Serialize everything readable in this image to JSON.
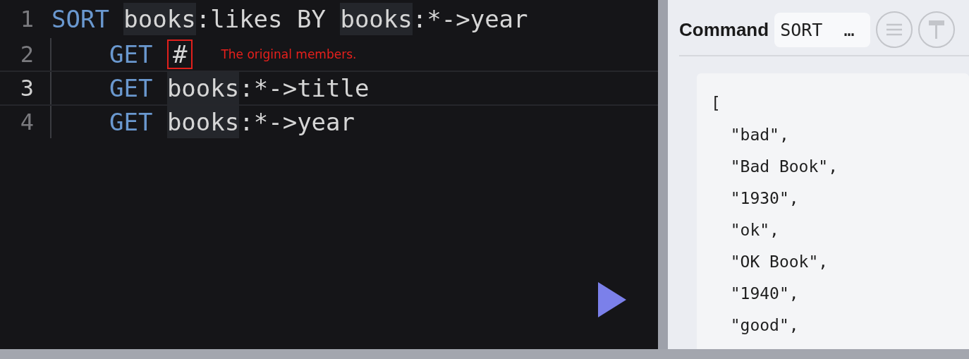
{
  "editor": {
    "lines": [
      {
        "number": "1",
        "active": false,
        "indented": false,
        "tokens": [
          {
            "kind": "keyword",
            "text": "SORT"
          },
          {
            "kind": "highlight",
            "text": "books"
          },
          {
            "kind": "plain",
            "text": ":likes BY "
          },
          {
            "kind": "highlight",
            "text": "books"
          },
          {
            "kind": "plain",
            "text": ":*->year"
          }
        ]
      },
      {
        "number": "2",
        "active": false,
        "indented": true,
        "tokens": [
          {
            "kind": "keyword",
            "text": "GET"
          },
          {
            "kind": "marked",
            "text": "#"
          }
        ],
        "note": "The original members."
      },
      {
        "number": "3",
        "active": true,
        "indented": true,
        "tokens": [
          {
            "kind": "keyword",
            "text": "GET"
          },
          {
            "kind": "highlight",
            "text": "books"
          },
          {
            "kind": "plain",
            "text": ":*->title"
          }
        ]
      },
      {
        "number": "4",
        "active": false,
        "indented": true,
        "tokens": [
          {
            "kind": "keyword",
            "text": "GET"
          },
          {
            "kind": "highlight",
            "text": "books"
          },
          {
            "kind": "plain",
            "text": ":*->year"
          }
        ]
      }
    ]
  },
  "panel": {
    "label": "Command",
    "command_value": "SORT  …",
    "output": [
      "[",
      "  \"bad\",",
      "  \"Bad Book\",",
      "  \"1930\",",
      "  \"ok\",",
      "  \"OK Book\",",
      "  \"1940\",",
      "  \"good\","
    ]
  }
}
